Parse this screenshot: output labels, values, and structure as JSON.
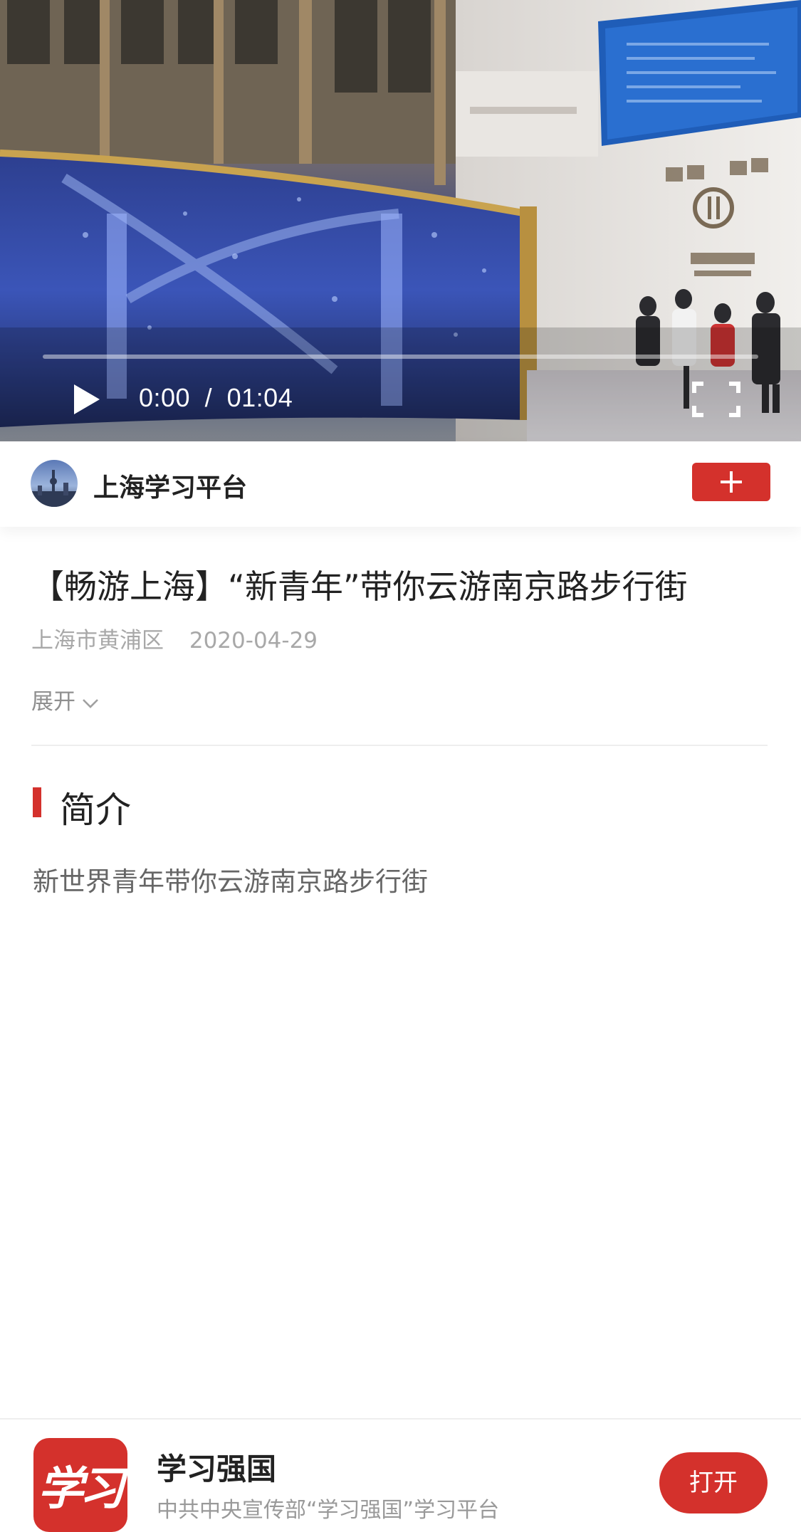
{
  "video": {
    "time_current": "0:00",
    "time_separator": "/",
    "time_total": "01:04",
    "progress": 0.0
  },
  "channel": {
    "name": "上海学习平台"
  },
  "article": {
    "title": "【畅游上海】“新青年”带你云游南京路步行街",
    "location": "上海市黄浦区",
    "date": "2020-04-29",
    "expand_label": "展开"
  },
  "intro": {
    "heading": "简介",
    "text": "新世界青年带你云游南京路步行街"
  },
  "app_banner": {
    "logo_text": "学习",
    "name": "学习强国",
    "subtitle": "中共中央宣传部“学习强国”学习平台",
    "open_label": "打开"
  },
  "colors": {
    "accent_red": "#d4312c",
    "meta_gray": "#a8a8a8"
  },
  "icons": [
    "play-icon",
    "fullscreen-icon",
    "plus-icon",
    "chevron-down-icon"
  ]
}
